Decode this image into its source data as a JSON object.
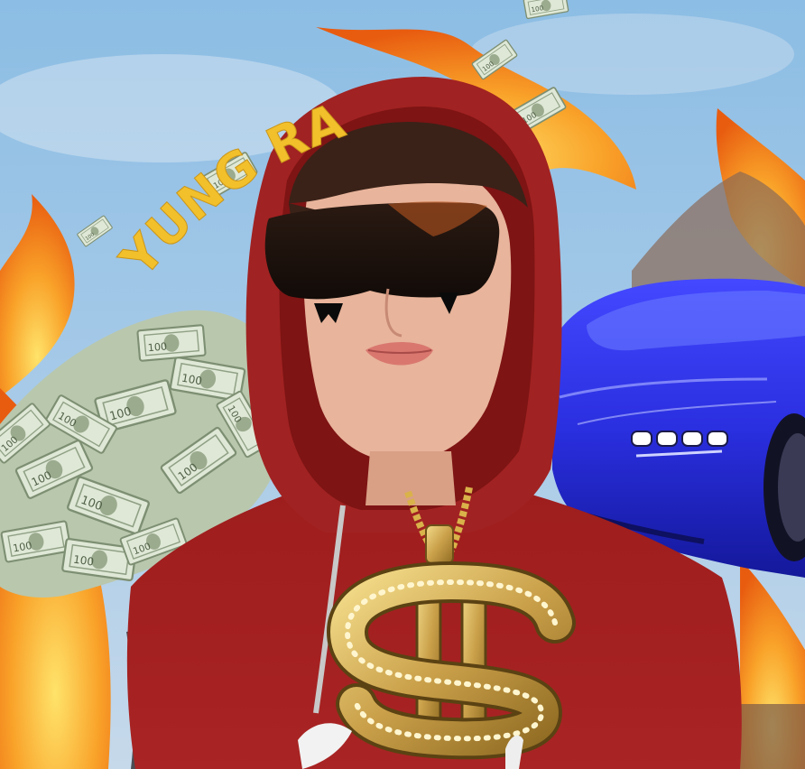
{
  "artwork": {
    "caption": "YUNG RA",
    "colors": {
      "sky_top": "#8fbfe4",
      "sky_bottom": "#c9dced",
      "caption": "#f2c02b",
      "hoodie": "#a8201f",
      "hoodie_shadow": "#7a1413",
      "skin": "#e9b39a",
      "hair": "#3a2218",
      "glasses": "#1b1410",
      "gold": "#d9b24a",
      "car_blue": "#2a2fe0",
      "fire_outer": "#f07a14",
      "fire_inner": "#ffd54a",
      "money_green": "#c8d6bf"
    },
    "elements": [
      "sky-background",
      "flames",
      "money-pile",
      "flying-bills",
      "blue-sports-car",
      "hooded-person",
      "sunglasses",
      "dollar-chain-pendant",
      "yung-ra-caption"
    ]
  }
}
